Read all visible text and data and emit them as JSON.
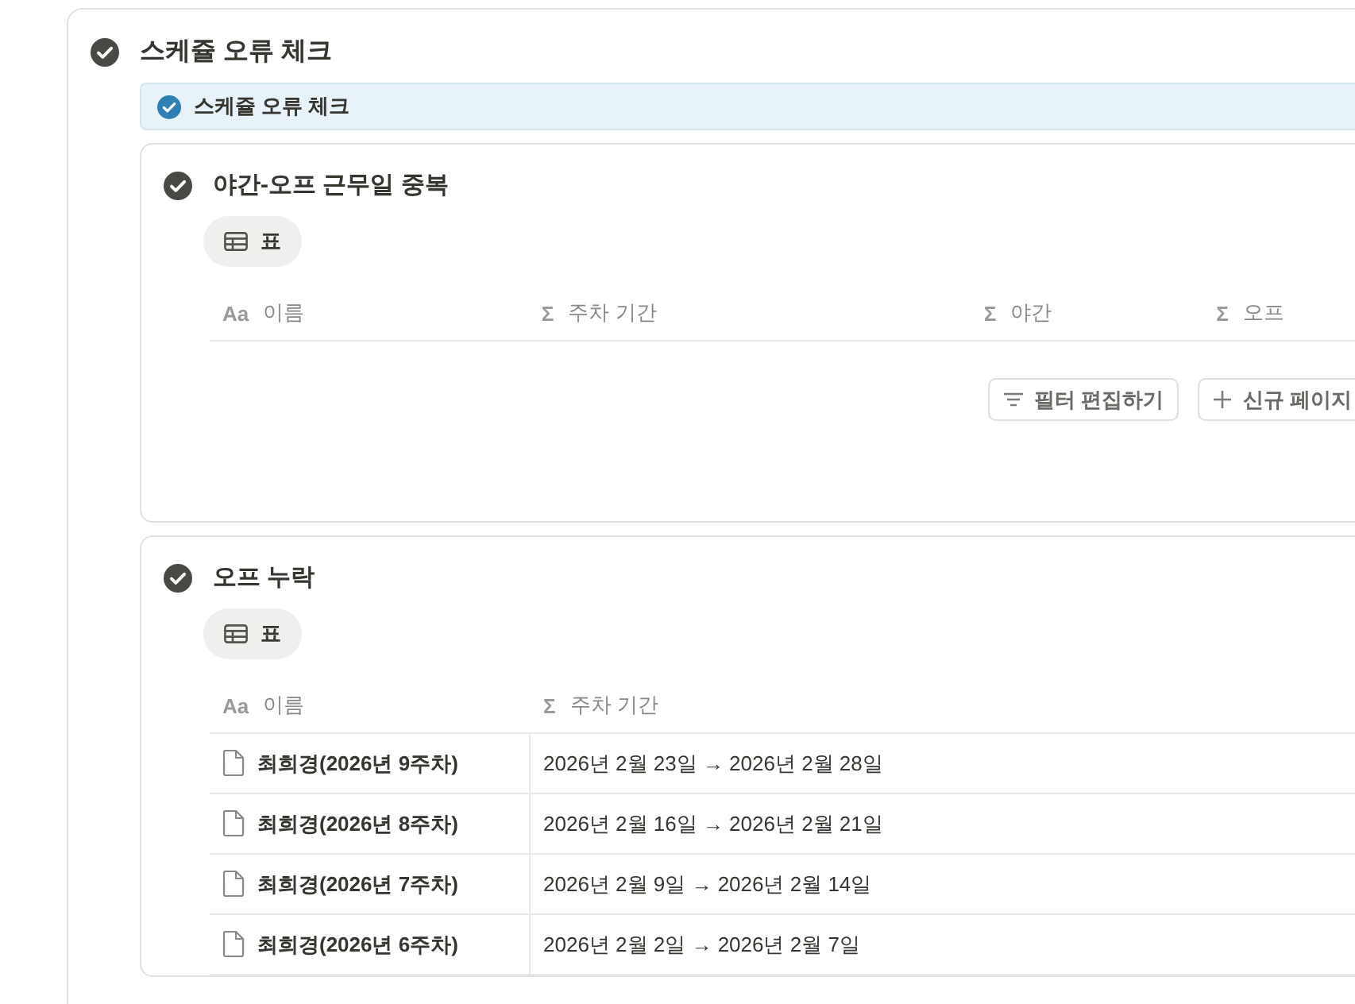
{
  "section": {
    "title": "스케쥴 오류 체크"
  },
  "callout": {
    "text": "스케쥴 오류 체크"
  },
  "views": [
    {
      "title": "야간-오프 근무일 중복",
      "view_tabs": [
        {
          "label": "표",
          "selected": true
        }
      ],
      "columns": [
        {
          "icon": "Aa",
          "label": "이름"
        },
        {
          "icon": "Σ",
          "label": "주차 기간"
        },
        {
          "icon": "Σ",
          "label": "야간"
        },
        {
          "icon": "Σ",
          "label": "오프"
        }
      ],
      "buttons": [
        {
          "kind": "filter",
          "label": "필터 편집하기"
        },
        {
          "kind": "add",
          "label": "신규 페이지"
        }
      ]
    },
    {
      "title": "오프 누락",
      "view_tabs": [
        {
          "label": "표",
          "selected": true
        }
      ],
      "columns": [
        {
          "icon": "Aa",
          "label": "이름"
        },
        {
          "icon": "Σ",
          "label": "주차 기간"
        }
      ],
      "rows": [
        {
          "name": "최희경(2026년 9주차)",
          "period": "2026년 2월 23일 → 2026년 2월 28일"
        },
        {
          "name": "최희경(2026년 8주차)",
          "period": "2026년 2월 16일 → 2026년 2월 21일"
        },
        {
          "name": "최희경(2026년 7주차)",
          "period": "2026년 2월 9일 → 2026년 2월 14일"
        },
        {
          "name": "최희경(2026년 6주차)",
          "period": "2026년 2월 2일 → 2026년 2월 7일"
        }
      ]
    }
  ]
}
